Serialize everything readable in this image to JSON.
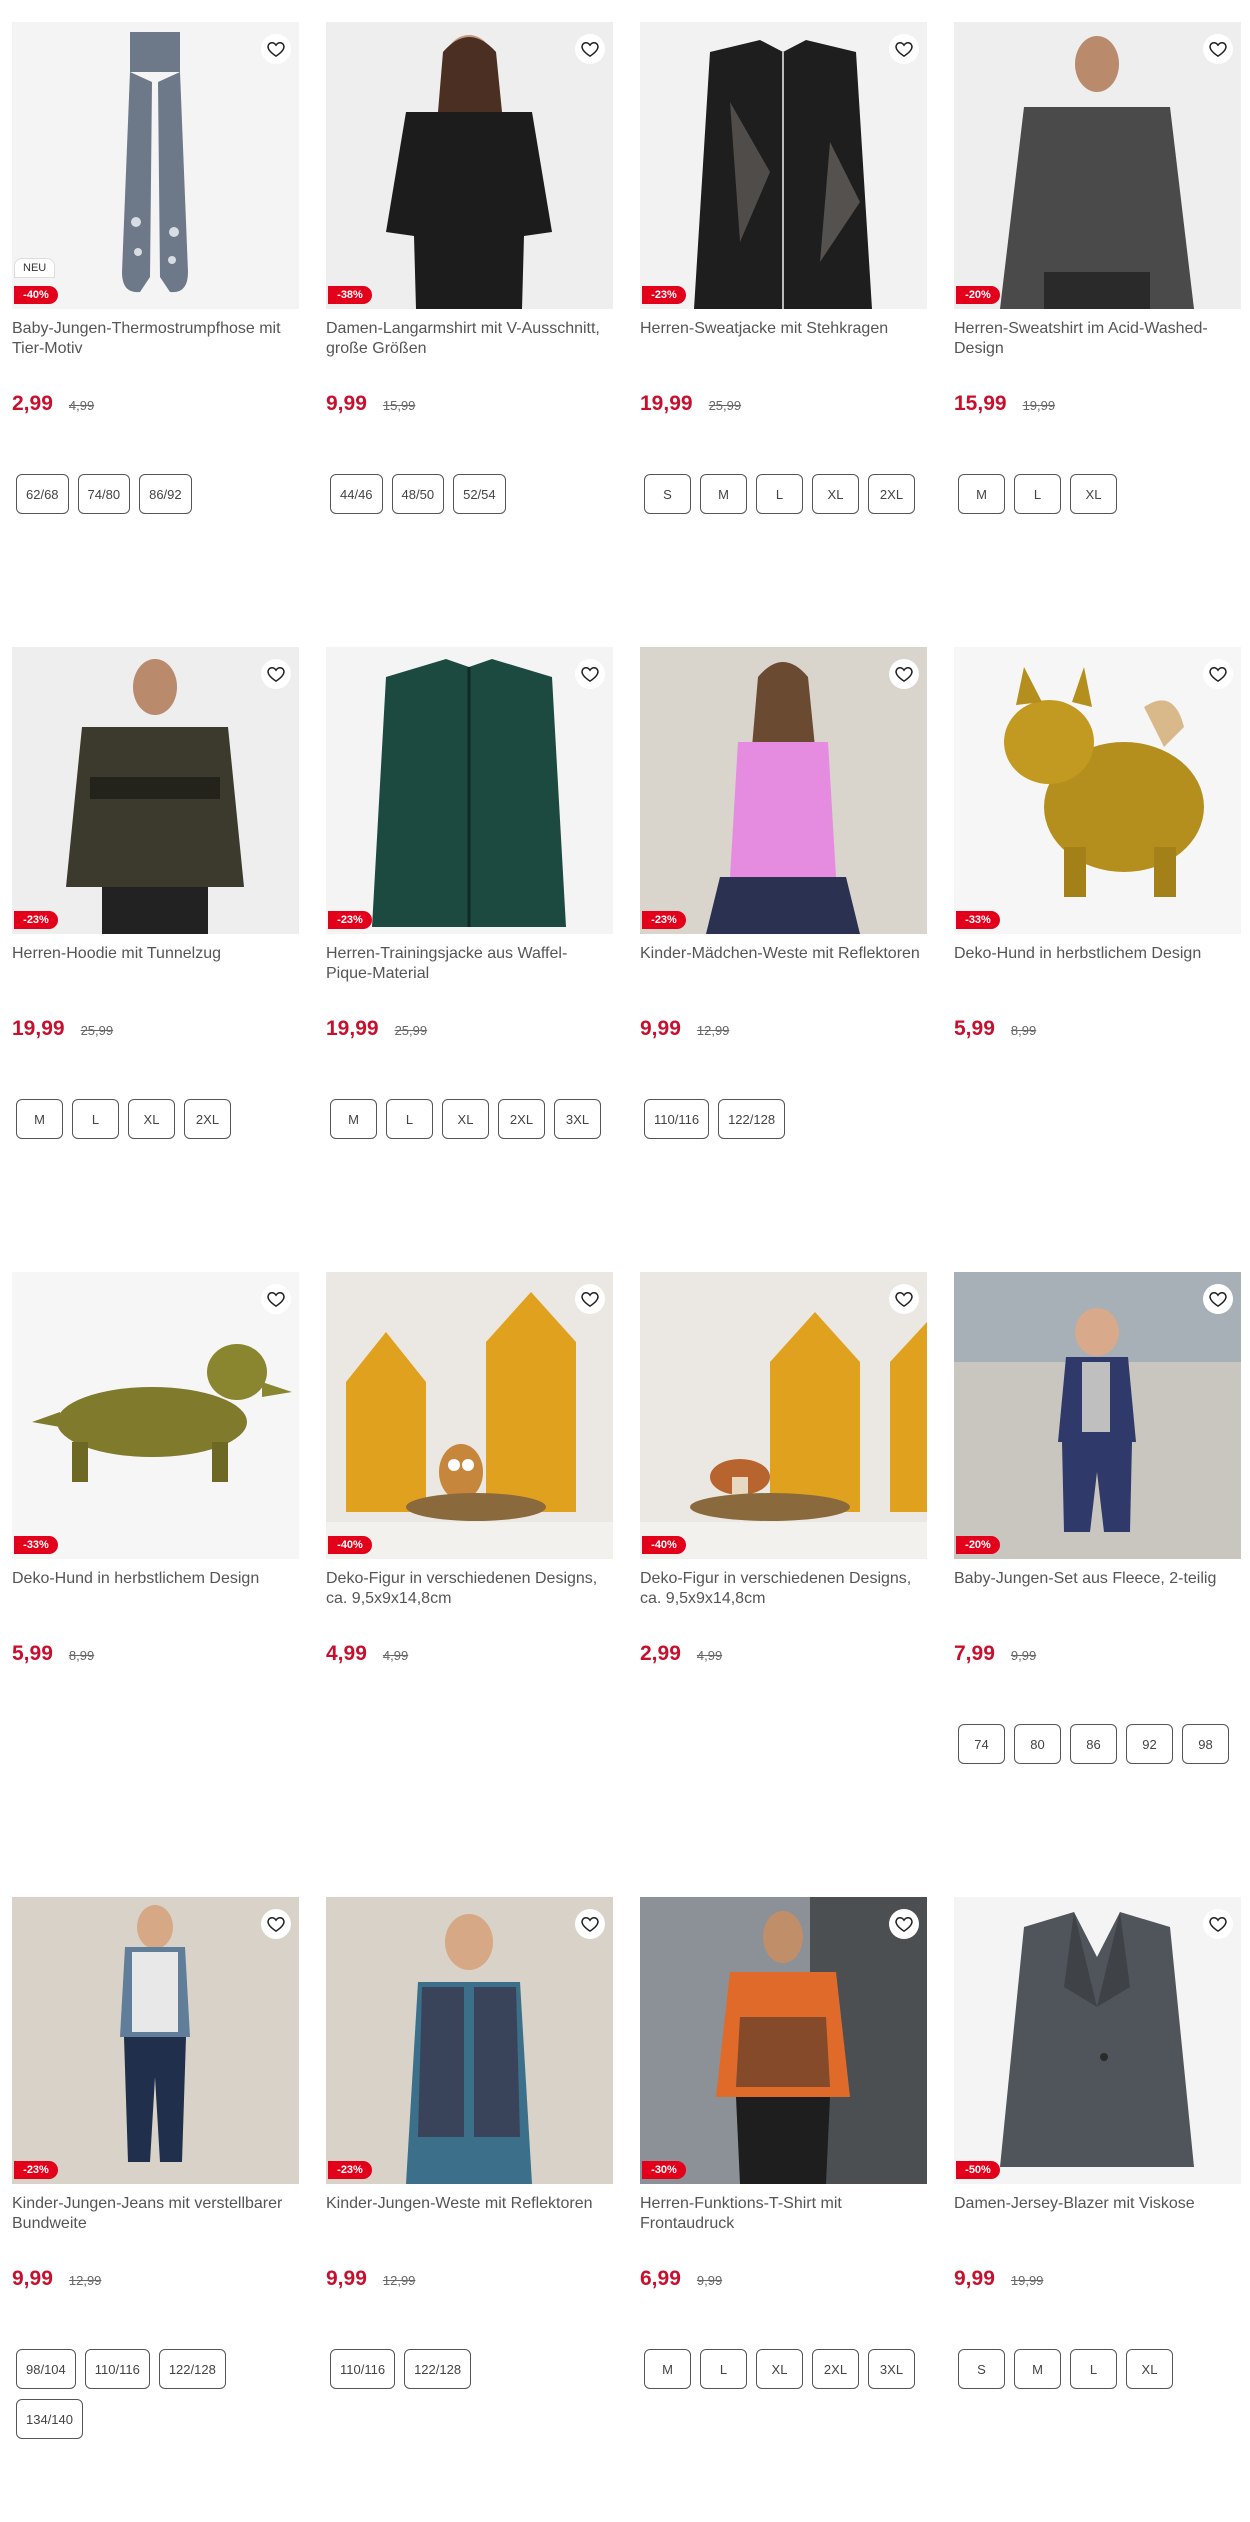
{
  "products": [
    {
      "name": "Baby-Jungen-Thermostrumpfhose mit Tier-Motiv",
      "price": "2,99",
      "old_price": "4,99",
      "discount": "-40%",
      "badge": "NEU",
      "sizes": [
        "62/68",
        "74/80",
        "86/92"
      ],
      "image": "tights",
      "bg": "#f4f4f4"
    },
    {
      "name": "Damen-Langarmshirt mit V-Ausschnitt, große Größen",
      "price": "9,99",
      "old_price": "15,99",
      "discount": "-38%",
      "sizes": [
        "44/46",
        "48/50",
        "52/54"
      ],
      "image": "woman-black-shirt",
      "bg": "#eeeeee"
    },
    {
      "name": "Herren-Sweatjacke mit Stehkragen",
      "price": "19,99",
      "old_price": "25,99",
      "discount": "-23%",
      "sizes": [
        "S",
        "M",
        "L",
        "XL",
        "2XL"
      ],
      "image": "black-jacket",
      "bg": "#f2f2f2"
    },
    {
      "name": "Herren-Sweatshirt im Acid-Washed-Design",
      "price": "15,99",
      "old_price": "19,99",
      "discount": "-20%",
      "sizes": [
        "M",
        "L",
        "XL"
      ],
      "image": "man-grey-sweatshirt",
      "bg": "#eeeeee"
    },
    {
      "name": "Herren-Hoodie mit Tunnelzug",
      "price": "19,99",
      "old_price": "25,99",
      "discount": "-23%",
      "sizes": [
        "M",
        "L",
        "XL",
        "2XL"
      ],
      "image": "man-olive-hoodie",
      "bg": "#eeeeee"
    },
    {
      "name": "Herren-Trainingsjacke aus Waffel-Pique-Material",
      "price": "19,99",
      "old_price": "25,99",
      "discount": "-23%",
      "sizes": [
        "M",
        "L",
        "XL",
        "2XL",
        "3XL"
      ],
      "image": "green-jacket",
      "bg": "#f4f4f4"
    },
    {
      "name": "Kinder-Mädchen-Weste mit Reflektoren",
      "price": "9,99",
      "old_price": "12,99",
      "discount": "-23%",
      "sizes": [
        "110/116",
        "122/128"
      ],
      "image": "girl-pink-vest",
      "bg": "#d9d4cc"
    },
    {
      "name": "Deko-Hund in herbstlichem Design",
      "price": "5,99",
      "old_price": "8,99",
      "discount": "-33%",
      "sizes": [],
      "image": "yellow-bulldog",
      "bg": "#f6f6f6"
    },
    {
      "name": "Deko-Hund in herbstlichem Design",
      "price": "5,99",
      "old_price": "8,99",
      "discount": "-33%",
      "sizes": [],
      "image": "green-dachshund",
      "bg": "#f6f6f6"
    },
    {
      "name": "Deko-Figur in verschiedenen Designs, ca. 9,5x9x14,8cm",
      "price": "4,99",
      "old_price": "4,99",
      "discount": "-40%",
      "sizes": [],
      "image": "deco-houses-owl",
      "bg": "#ebe7e2"
    },
    {
      "name": "Deko-Figur in verschiedenen Designs, ca. 9,5x9x14,8cm",
      "price": "2,99",
      "old_price": "4,99",
      "discount": "-40%",
      "sizes": [],
      "image": "deco-houses-mushroom",
      "bg": "#ebe7e2"
    },
    {
      "name": "Baby-Jungen-Set aus Fleece, 2-teilig",
      "price": "7,99",
      "old_price": "9,99",
      "discount": "-20%",
      "sizes": [
        "74",
        "80",
        "86",
        "92",
        "98"
      ],
      "image": "baby-fleece-set",
      "bg": "#c9c6c0"
    },
    {
      "name": "Kinder-Jungen-Jeans mit verstellbarer Bundweite",
      "price": "9,99",
      "old_price": "12,99",
      "discount": "-23%",
      "sizes": [
        "98/104",
        "110/116",
        "122/128",
        "134/140"
      ],
      "image": "boy-jeans",
      "bg": "#d8d2c8"
    },
    {
      "name": "Kinder-Jungen-Weste mit Reflektoren",
      "price": "9,99",
      "old_price": "12,99",
      "discount": "-23%",
      "sizes": [
        "110/116",
        "122/128"
      ],
      "image": "boy-vest",
      "bg": "#d8d2c8"
    },
    {
      "name": "Herren-Funktions-T-Shirt mit Frontaudruck",
      "price": "6,99",
      "old_price": "9,99",
      "discount": "-30%",
      "sizes": [
        "M",
        "L",
        "XL",
        "2XL",
        "3XL"
      ],
      "image": "man-power-tshirt",
      "bg": "#9aa0a4"
    },
    {
      "name": "Damen-Jersey-Blazer mit Viskose",
      "price": "9,99",
      "old_price": "19,99",
      "discount": "-50%",
      "sizes": [
        "S",
        "M",
        "L",
        "XL"
      ],
      "image": "grey-blazer",
      "bg": "#f4f4f4"
    }
  ],
  "icons": {
    "wishlist": "heart-outline-icon"
  },
  "colors": {
    "price": "#c8102e",
    "badge": "#e2001a"
  }
}
